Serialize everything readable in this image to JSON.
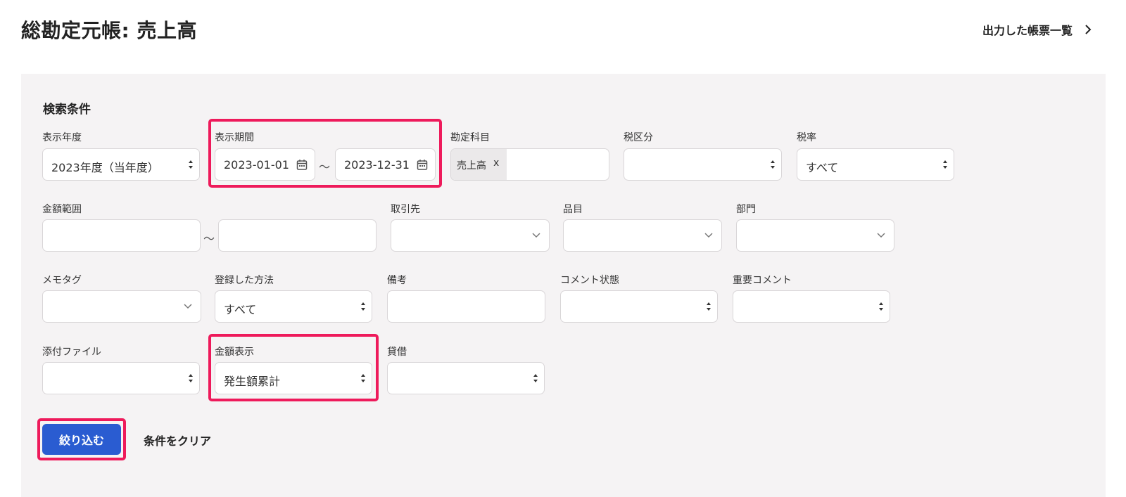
{
  "header": {
    "title": "総勘定元帳: 売上高",
    "report_list_link": "出力した帳票一覧"
  },
  "search": {
    "section_title": "検索条件",
    "fiscal_year": {
      "label": "表示年度",
      "value": "2023年度（当年度）"
    },
    "period": {
      "label": "表示期間",
      "start": "2023-01-01",
      "end": "2023-12-31",
      "separator": "～"
    },
    "account": {
      "label": "勘定科目",
      "tag": "売上高",
      "tag_remove": "x"
    },
    "tax_category": {
      "label": "税区分",
      "value": ""
    },
    "tax_rate": {
      "label": "税率",
      "value": "すべて"
    },
    "amount_range": {
      "label": "金額範囲",
      "min": "",
      "max": "",
      "separator": "～"
    },
    "partner": {
      "label": "取引先",
      "value": ""
    },
    "item": {
      "label": "品目",
      "value": ""
    },
    "department": {
      "label": "部門",
      "value": ""
    },
    "memo_tag": {
      "label": "メモタグ",
      "value": ""
    },
    "registration_method": {
      "label": "登録した方法",
      "value": "すべて"
    },
    "remarks": {
      "label": "備考",
      "value": ""
    },
    "comment_status": {
      "label": "コメント状態",
      "value": ""
    },
    "important_comment": {
      "label": "重要コメント",
      "value": ""
    },
    "attachment": {
      "label": "添付ファイル",
      "value": ""
    },
    "amount_display": {
      "label": "金額表示",
      "value": "発生額累計"
    },
    "debit_credit": {
      "label": "貸借",
      "value": ""
    },
    "filter_button": "絞り込む",
    "clear_link": "条件をクリア"
  },
  "colors": {
    "highlight": "#ee1a5b",
    "primary": "#2a5cd1",
    "panel_bg": "#f5f3f4"
  }
}
